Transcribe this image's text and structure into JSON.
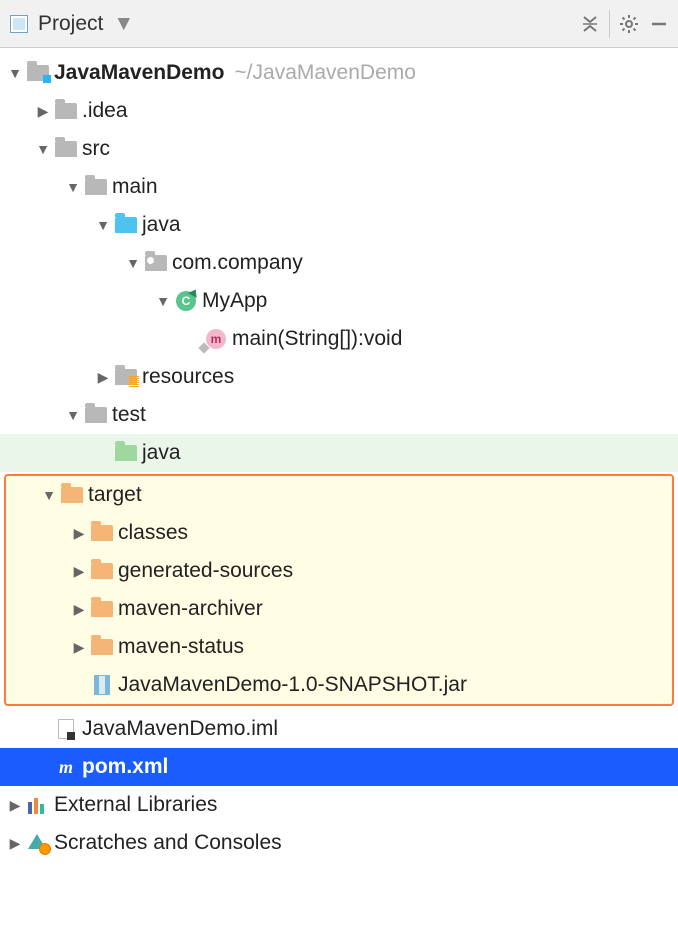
{
  "toolbar": {
    "title": "Project"
  },
  "tree": {
    "root": {
      "name": "JavaMavenDemo",
      "hint": "~/JavaMavenDemo"
    },
    "idea": ".idea",
    "src": "src",
    "main": "main",
    "java_main": "java",
    "pkg": "com.company",
    "cls": "MyApp",
    "cls_letter": "C",
    "method": "main(String[]):void",
    "method_letter": "m",
    "resources": "resources",
    "test": "test",
    "java_test": "java",
    "target": "target",
    "classes": "classes",
    "gensrc": "generated-sources",
    "archiver": "maven-archiver",
    "status": "maven-status",
    "jar": "JavaMavenDemo-1.0-SNAPSHOT.jar",
    "iml": "JavaMavenDemo.iml",
    "pom": "pom.xml",
    "ext": "External Libraries",
    "scratch": "Scratches and Consoles",
    "m_letter": "m"
  }
}
